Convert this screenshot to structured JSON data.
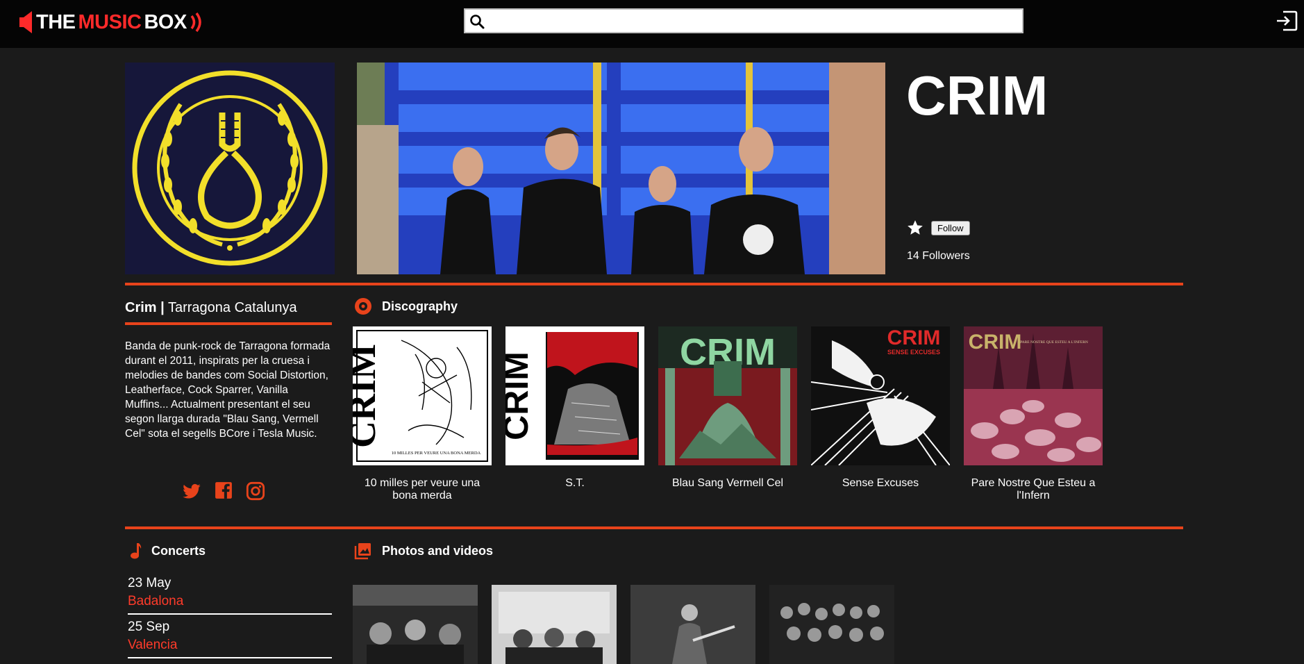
{
  "brand": {
    "part1": "THE",
    "part2": "MUSIC",
    "part3": "BOX",
    "accent": "#ff2a2a"
  },
  "search": {
    "placeholder": "",
    "value": ""
  },
  "icons": {
    "search": "search-icon",
    "login": "login-icon",
    "follow_star": "star-icon"
  },
  "band": {
    "name": "CRIM",
    "follow_label": "Follow",
    "followers_text": "14 Followers",
    "short_name": "Crim",
    "separator": "|",
    "location": "Tarragona Catalunya",
    "bio": "Banda de punk-rock de Tarragona formada durant el 2011, inspirats per la cruesa i melodies de bandes com Social Distortion, Leatherface, Cock Sparrer, Vanilla Muffins... Actualment presentant el seu segon llarga durada \"Blau Sang, Vermell Cel\" sota el segells BCore i Tesla Music."
  },
  "socials": [
    "twitter-icon",
    "facebook-icon",
    "instagram-icon"
  ],
  "discography": {
    "heading": "Discography",
    "albums": [
      {
        "title": "10 milles per veure una bona merda",
        "cover_text": "CRIM",
        "cover_sub": "10 MILLES PER VEURE UNA BONA MERDA"
      },
      {
        "title": "S.T.",
        "cover_text": "CRIM"
      },
      {
        "title": "Blau Sang Vermell Cel",
        "cover_text": "CRIM"
      },
      {
        "title": "Sense Excuses",
        "cover_text": "CRIM",
        "cover_sub": "SENSE EXCUSES"
      },
      {
        "title": "Pare Nostre Que Esteu a l'Infern",
        "cover_text": "CRIM",
        "cover_sub": "PARE NOSTRE QUE ESTEU A L'INFERN"
      }
    ]
  },
  "concerts": {
    "heading": "Concerts",
    "items": [
      {
        "date": "23 May",
        "city": "Badalona"
      },
      {
        "date": "25 Sep",
        "city": "Valencia"
      }
    ]
  },
  "media": {
    "heading": "Photos and videos",
    "thumb_count_visible": 4
  },
  "colors": {
    "accent": "#e8431b",
    "background": "#1b1b1b",
    "topbar": "#050505",
    "city_link": "#ff3b2a"
  }
}
